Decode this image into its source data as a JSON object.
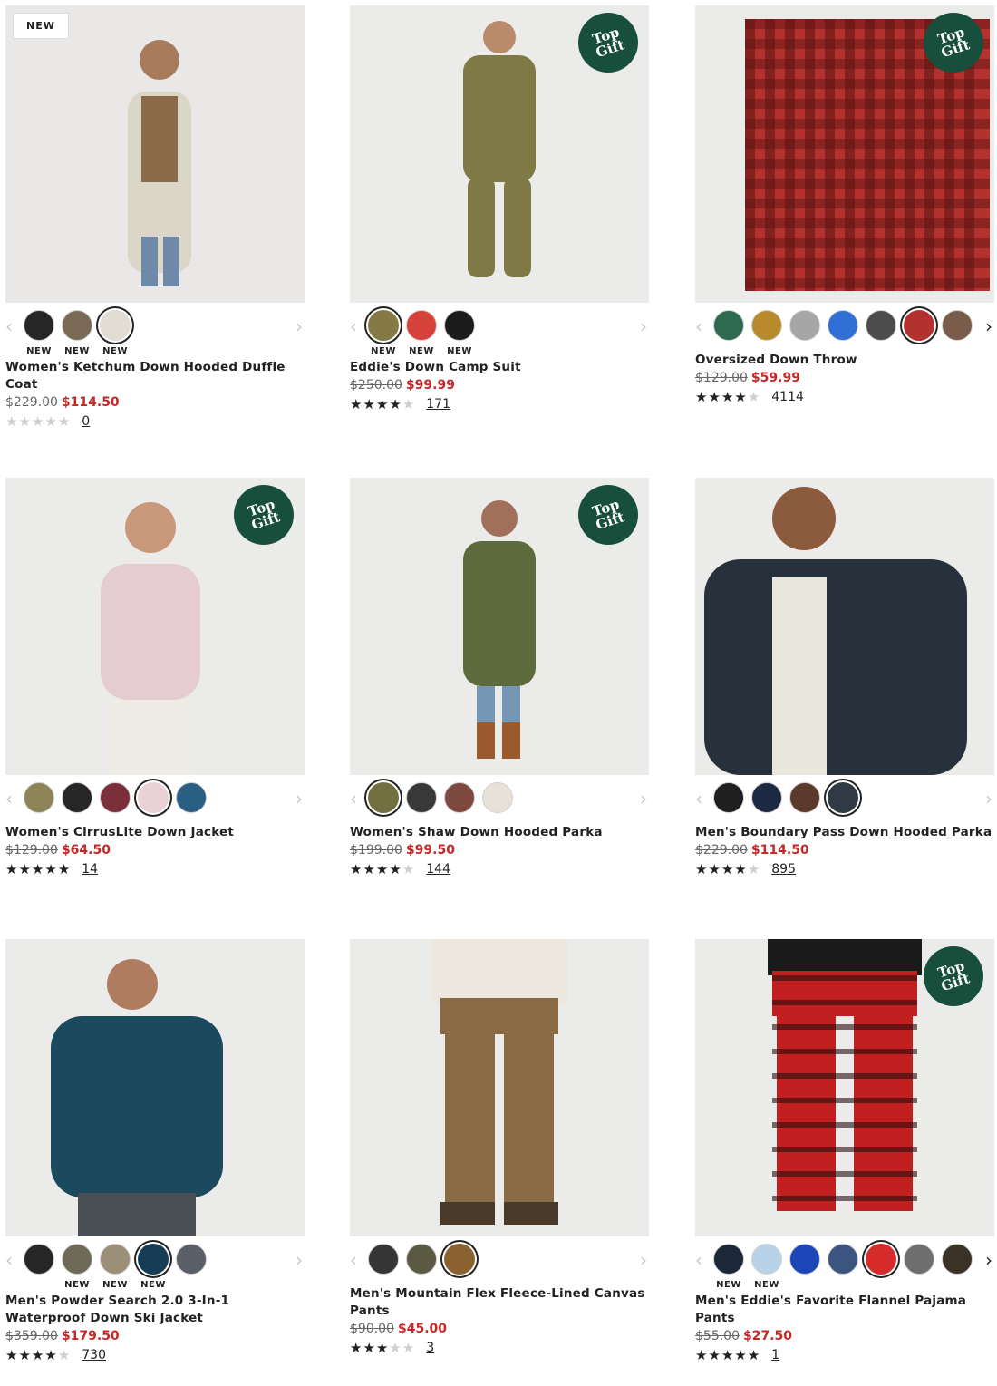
{
  "products": [
    {
      "name": "Women's Ketchum Down Hooded Duffle Coat",
      "badge": "NEW",
      "gift": "",
      "bg": "#e9e8e6",
      "old_price": "$229.00",
      "sale_price": "$114.50",
      "rating": 0,
      "reviews": "0",
      "right_arrow_dark": false,
      "swatches": [
        {
          "color": "#262626",
          "tag": "NEW",
          "selected": false
        },
        {
          "color": "#7a6a55",
          "tag": "NEW",
          "selected": false
        },
        {
          "color": "#e2ddd2",
          "tag": "NEW",
          "selected": true
        }
      ]
    },
    {
      "name": "Eddie's Down Camp Suit",
      "badge": "",
      "gift": "Top\nGift",
      "bg": "#ebebea",
      "old_price": "$250.00",
      "sale_price": "$99.99",
      "rating": 4.5,
      "reviews": "171",
      "right_arrow_dark": false,
      "swatches": [
        {
          "color": "#857a45",
          "tag": "NEW",
          "selected": true
        },
        {
          "color": "#d6423a",
          "tag": "NEW",
          "selected": false
        },
        {
          "color": "#1c1c1c",
          "tag": "NEW",
          "selected": false
        }
      ]
    },
    {
      "name": "Oversized Down Throw",
      "badge": "",
      "gift": "Top\nGift",
      "bg": "#ebebea",
      "old_price": "$129.00",
      "sale_price": "$59.99",
      "rating": 4.5,
      "reviews": "4114",
      "right_arrow_dark": true,
      "swatches": [
        {
          "color": "#2d6a4f",
          "tag": "",
          "selected": false
        },
        {
          "color": "#b88a2c",
          "tag": "",
          "selected": false
        },
        {
          "color": "#a6a6a6",
          "tag": "",
          "selected": false
        },
        {
          "color": "#2f6fd6",
          "tag": "",
          "selected": false
        },
        {
          "color": "#4c4c4c",
          "tag": "",
          "selected": false
        },
        {
          "color": "#b3312e",
          "tag": "",
          "selected": true
        },
        {
          "color": "#7a5c4a",
          "tag": "",
          "selected": false
        }
      ]
    },
    {
      "name": "Women's CirrusLite Down Jacket",
      "badge": "",
      "gift": "Top\nGift",
      "bg": "#ebebea",
      "old_price": "$129.00",
      "sale_price": "$64.50",
      "rating": 5,
      "reviews": "14",
      "right_arrow_dark": false,
      "swatches": [
        {
          "color": "#8d8458",
          "tag": "",
          "selected": false
        },
        {
          "color": "#262626",
          "tag": "",
          "selected": false
        },
        {
          "color": "#7b2f3a",
          "tag": "",
          "selected": false
        },
        {
          "color": "#e9d2d6",
          "tag": "",
          "selected": true
        },
        {
          "color": "#2a5f83",
          "tag": "",
          "selected": false
        }
      ]
    },
    {
      "name": "Women's Shaw Down Hooded Parka",
      "badge": "",
      "gift": "Top\nGift",
      "bg": "#ebebea",
      "old_price": "$199.00",
      "sale_price": "$99.50",
      "rating": 4.5,
      "reviews": "144",
      "right_arrow_dark": false,
      "swatches": [
        {
          "color": "#727041",
          "tag": "",
          "selected": true
        },
        {
          "color": "#383838",
          "tag": "",
          "selected": false
        },
        {
          "color": "#7e4a40",
          "tag": "",
          "selected": false
        },
        {
          "color": "#e7e1d7",
          "tag": "",
          "selected": false
        }
      ]
    },
    {
      "name": "Men's Boundary Pass Down Hooded Parka",
      "badge": "",
      "gift": "",
      "bg": "#ebebea",
      "old_price": "$229.00",
      "sale_price": "$114.50",
      "rating": 4.5,
      "reviews": "895",
      "right_arrow_dark": false,
      "swatches": [
        {
          "color": "#1f1f1f",
          "tag": "",
          "selected": false
        },
        {
          "color": "#1e2a44",
          "tag": "",
          "selected": false
        },
        {
          "color": "#5b3a2c",
          "tag": "",
          "selected": false
        },
        {
          "color": "#2f3a44",
          "tag": "",
          "selected": true
        }
      ]
    },
    {
      "name": "Men's Powder Search 2.0 3-In-1 Waterproof Down Ski Jacket",
      "badge": "",
      "gift": "",
      "bg": "#ebebea",
      "old_price": "$359.00",
      "sale_price": "$179.50",
      "rating": 4.5,
      "reviews": "730",
      "right_arrow_dark": false,
      "swatches": [
        {
          "color": "#262626",
          "tag": "",
          "selected": false
        },
        {
          "color": "#6f6a55",
          "tag": "NEW",
          "selected": false
        },
        {
          "color": "#9c8f78",
          "tag": "NEW",
          "selected": false
        },
        {
          "color": "#163d55",
          "tag": "NEW",
          "selected": true
        },
        {
          "color": "#5a5e66",
          "tag": "",
          "selected": false
        }
      ]
    },
    {
      "name": "Men's Mountain Flex Fleece-Lined Canvas Pants",
      "badge": "",
      "gift": "",
      "bg": "#ebebea",
      "old_price": "$90.00",
      "sale_price": "$45.00",
      "rating": 3,
      "reviews": "3",
      "right_arrow_dark": false,
      "swatches": [
        {
          "color": "#363636",
          "tag": "",
          "selected": false
        },
        {
          "color": "#5c5a42",
          "tag": "",
          "selected": false
        },
        {
          "color": "#8a6230",
          "tag": "",
          "selected": true
        }
      ]
    },
    {
      "name": "Men's Eddie's Favorite Flannel Pajama Pants",
      "badge": "",
      "gift": "Top\nGift",
      "bg": "#ebebea",
      "old_price": "$55.00",
      "sale_price": "$27.50",
      "rating": 5,
      "reviews": "1",
      "right_arrow_dark": true,
      "swatches": [
        {
          "color": "#1c2738",
          "tag": "NEW",
          "selected": false
        },
        {
          "color": "#b8d3e8",
          "tag": "NEW",
          "selected": false
        },
        {
          "color": "#1d47b8",
          "tag": "",
          "selected": false
        },
        {
          "color": "#3c5580",
          "tag": "",
          "selected": false
        },
        {
          "color": "#d62b2b",
          "tag": "",
          "selected": true
        },
        {
          "color": "#6e6e6e",
          "tag": "",
          "selected": false
        },
        {
          "color": "#3a3226",
          "tag": "",
          "selected": false
        }
      ]
    }
  ],
  "icons": {
    "prev": "‹",
    "next": "›"
  }
}
